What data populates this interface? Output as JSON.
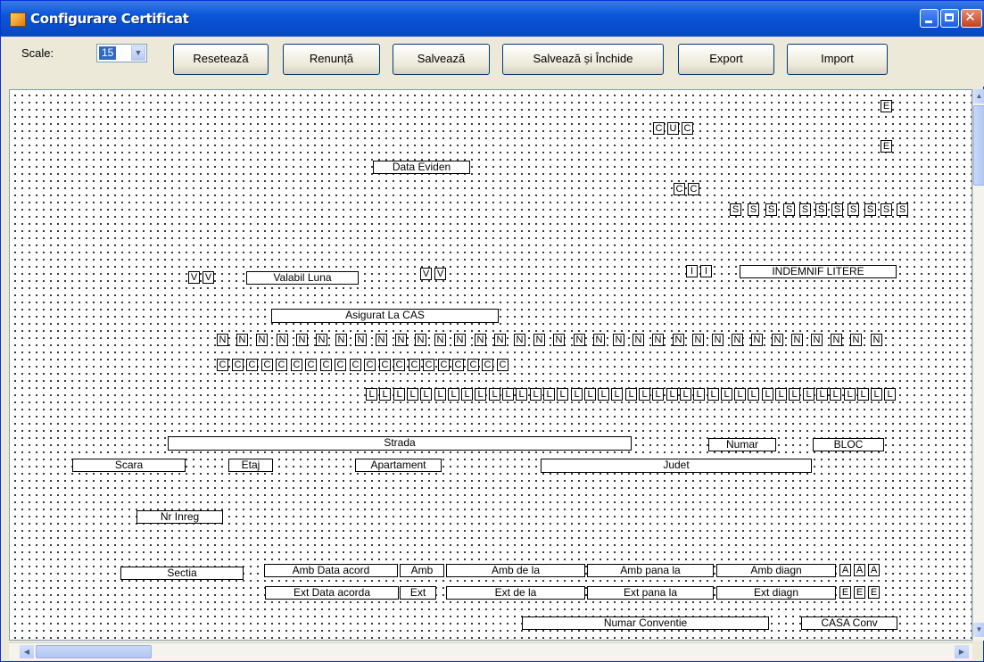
{
  "window": {
    "title": "Configurare Certificat"
  },
  "toolbar": {
    "scale_label": "Scale:",
    "scale_value": "15",
    "buttons": [
      "Resetează",
      "Renunță",
      "Salvează",
      "Salvează și Închide",
      "Export",
      "Import"
    ]
  },
  "fields": {
    "data_evident": "Data Eviden",
    "valabil_luna": "Valabil Luna",
    "indemnif_litere": "INDEMNIF LITERE",
    "asigurat_la_cas": "Asigurat La CAS",
    "strada": "Strada",
    "numar": "Numar",
    "bloc": "BLOC",
    "scara": "Scara",
    "etaj": "Etaj",
    "apartament": "Apartament",
    "judet": "Judet",
    "nr_inreg": "Nr Inreg",
    "sectia": "Sectia",
    "amb_data_acord": "Amb Data acord",
    "amb": "Amb",
    "amb_de_la": "Amb de la",
    "amb_pana_la": "Amb pana la",
    "amb_diagn": "Amb diagn",
    "ext_data_acorda": "Ext Data acorda",
    "ext": "Ext",
    "ext_de_la": "Ext de la",
    "ext_pana_la": "Ext pana la",
    "ext_diagn": "Ext diagn",
    "numar_conventie": "Numar Conventie",
    "casa_conv": "CASA Conv"
  },
  "letters": {
    "E": "E",
    "U": "U",
    "C": "C",
    "S": "S",
    "V": "V",
    "I": "I",
    "N": "N",
    "L": "L",
    "A": "A"
  }
}
